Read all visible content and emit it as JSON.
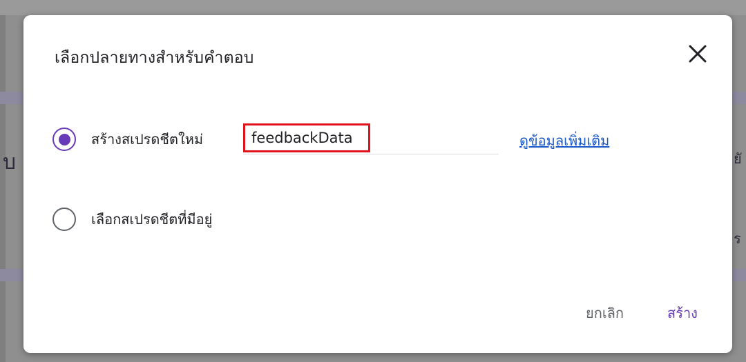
{
  "dialog": {
    "title": "เลือกปลายทางสำหรับคำตอบ",
    "close_icon": "close-icon",
    "options": {
      "new_spreadsheet": {
        "label": "สร้างสเปรดชีตใหม่",
        "selected": true,
        "input_value": "feedbackData",
        "learn_more": "ดูข้อมูลเพิ่มเติม"
      },
      "existing_spreadsheet": {
        "label": "เลือกสเปรดชีตที่มีอยู่",
        "selected": false
      }
    },
    "buttons": {
      "cancel": "ยกเลิก",
      "create": "สร้าง"
    }
  },
  "background": {
    "left_fragment": "บ",
    "right_fragment_1": "ยั",
    "right_fragment_2": "ร"
  },
  "colors": {
    "accent": "#673ab7",
    "link": "#1a57c8",
    "highlight_border": "#e2121b"
  }
}
